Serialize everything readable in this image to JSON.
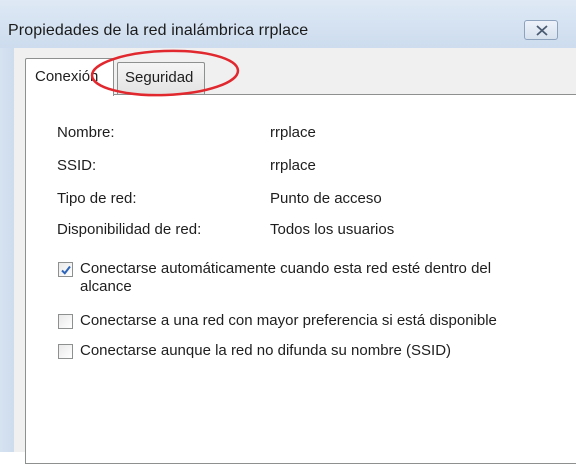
{
  "window": {
    "title": "Propiedades de la red inalámbrica rrplace"
  },
  "tabs": [
    {
      "label": "Conexión",
      "selected": true
    },
    {
      "label": "Seguridad",
      "selected": false,
      "highlighted": true
    }
  ],
  "properties": [
    {
      "label": "Nombre:",
      "value": "rrplace"
    },
    {
      "label": "SSID:",
      "value": "rrplace"
    },
    {
      "label": "Tipo de red:",
      "value": "Punto de acceso"
    },
    {
      "label": "Disponibilidad de red:",
      "value": "Todos los usuarios"
    }
  ],
  "options": [
    {
      "label": "Conectarse automáticamente cuando esta red esté dentro del",
      "label_line2": "alcance",
      "checked": true
    },
    {
      "label": "Conectarse a una red con mayor preferencia si está disponible",
      "checked": false
    },
    {
      "label": "Conectarse aunque la red no difunda su nombre (SSID)",
      "checked": false
    }
  ],
  "colors": {
    "annotation": "#e0282e",
    "check": "#2b64b8"
  }
}
